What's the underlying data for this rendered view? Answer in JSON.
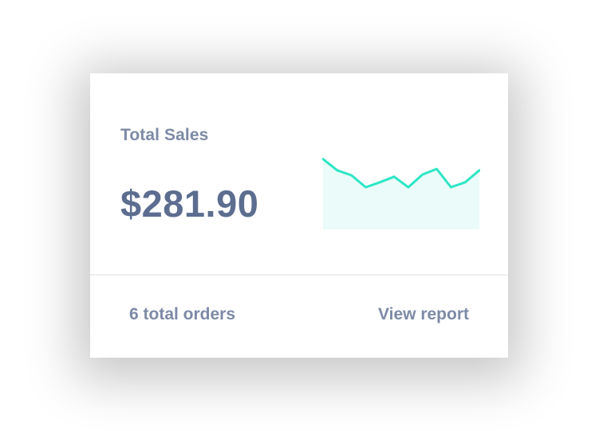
{
  "card": {
    "title": "Total Sales",
    "amount": "$281.90",
    "orders_text": "6 total orders",
    "report_link": "View report"
  },
  "sparkline": {
    "points": [
      100,
      84,
      77,
      60,
      67,
      75,
      60,
      78,
      86,
      60,
      67,
      84
    ],
    "range": [
      0,
      120
    ],
    "line_color": "#2ee6c5",
    "fill_color": "#eafbf9"
  },
  "colors": {
    "label": "#7d8aa6",
    "amount": "#5c6d8f",
    "divider": "#eef0f4"
  }
}
